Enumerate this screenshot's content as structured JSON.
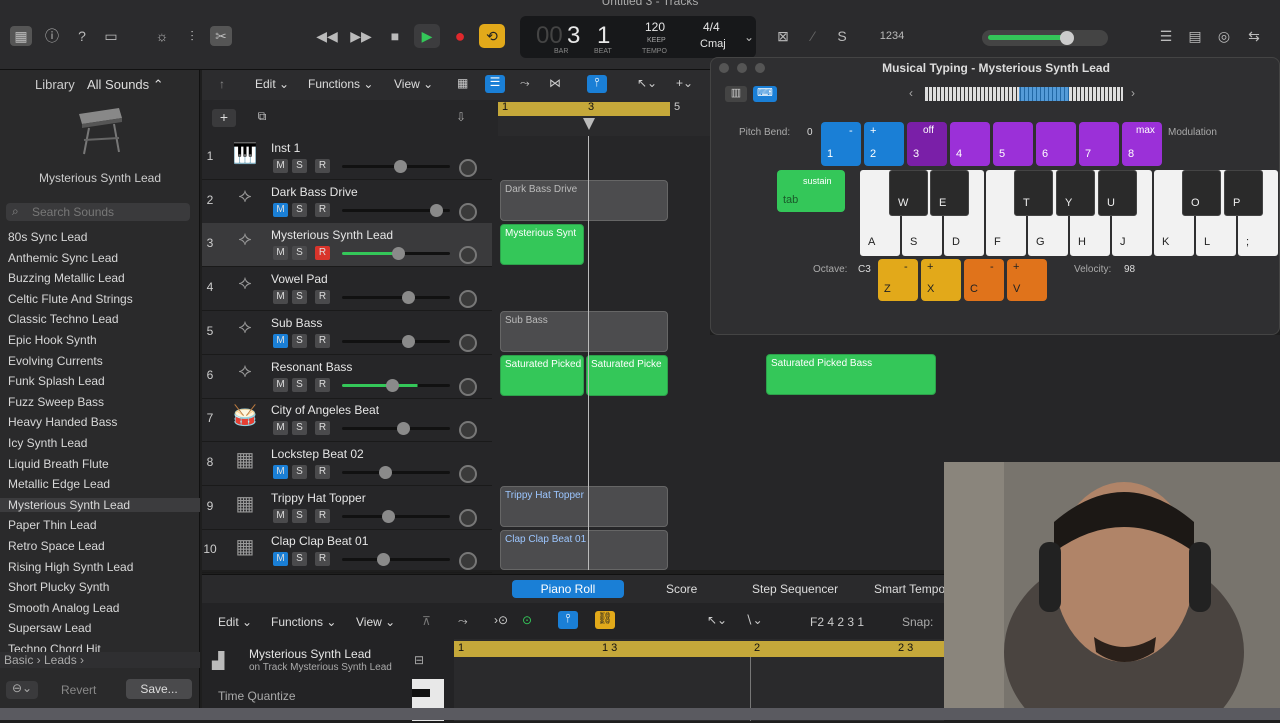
{
  "window_title": "Untitled 3 - Tracks",
  "lcd": {
    "bar": "3",
    "beat": "1",
    "bar_label": "BAR",
    "beat_label": "BEAT",
    "tempo": "120",
    "keep": "KEEP",
    "tempo_label": "TEMPO",
    "signature": "4/4",
    "key": "Cmaj",
    "prefix": "00"
  },
  "toolbar": {
    "count_in": "1234"
  },
  "library": {
    "title": "Library",
    "filter": "All Sounds",
    "selected_patch": "Mysterious Synth Lead",
    "search_placeholder": "Search Sounds",
    "items": [
      "80s Sync Lead",
      "Anthemic Sync Lead",
      "Buzzing Metallic Lead",
      "Celtic Flute And Strings",
      "Classic Techno Lead",
      "Epic Hook Synth",
      "Evolving Currents",
      "Funk Splash Lead",
      "Fuzz Sweep Bass",
      "Heavy Handed Bass",
      "Icy Synth Lead",
      "Liquid Breath Flute",
      "Metallic Edge Lead",
      "Mysterious Synth Lead",
      "Paper Thin Lead",
      "Retro Space Lead",
      "Rising High Synth Lead",
      "Short Plucky Synth",
      "Smooth Analog Lead",
      "Supersaw Lead",
      "Techno Chord Hit"
    ],
    "breadcrumb": "Basic › Leads ›",
    "revert": "Revert",
    "save": "Save..."
  },
  "tracks_menu": {
    "edit": "Edit",
    "functions": "Functions",
    "view": "View"
  },
  "ruler": {
    "m1": "1",
    "m3": "3",
    "m5": "5"
  },
  "tracks": [
    {
      "num": "1",
      "name": "Inst 1",
      "m": "M",
      "s": "S",
      "r": "R",
      "vol": 0.52
    },
    {
      "num": "2",
      "name": "Dark Bass Drive",
      "m": "M",
      "s": "S",
      "r": "R",
      "vol": 0.88
    },
    {
      "num": "3",
      "name": "Mysterious Synth Lead",
      "m": "M",
      "s": "S",
      "r": "R",
      "vol": 0.5
    },
    {
      "num": "4",
      "name": "Vowel Pad",
      "m": "M",
      "s": "S",
      "r": "R",
      "vol": 0.6
    },
    {
      "num": "5",
      "name": "Sub Bass",
      "m": "M",
      "s": "S",
      "r": "R",
      "vol": 0.6
    },
    {
      "num": "6",
      "name": "Resonant Bass",
      "m": "M",
      "s": "S",
      "r": "R",
      "vol": 0.44
    },
    {
      "num": "7",
      "name": "City of Angeles Beat",
      "m": "M",
      "s": "S",
      "r": "R",
      "vol": 0.55
    },
    {
      "num": "8",
      "name": "Lockstep Beat 02",
      "m": "M",
      "s": "S",
      "r": "R",
      "vol": 0.37
    },
    {
      "num": "9",
      "name": "Trippy Hat Topper",
      "m": "M",
      "s": "S",
      "r": "R",
      "vol": 0.4
    },
    {
      "num": "10",
      "name": "Clap Clap Beat 01",
      "m": "M",
      "s": "S",
      "r": "R",
      "vol": 0.35
    }
  ],
  "regions": {
    "dark_bass": "Dark Bass Drive",
    "myst": "Mysterious Synt",
    "sub": "Sub Bass",
    "sat1": "Saturated Picked",
    "sat2": "Saturated Picke",
    "sat3": "Saturated Picked Bass",
    "hat": "Trippy Hat Topper",
    "clap": "Clap Clap Beat 01"
  },
  "musical_typing": {
    "title": "Musical Typing - Mysterious Synth Lead",
    "pitch_bend_label": "Pitch Bend:",
    "pitch_bend_value": "0",
    "modulation_label": "Modulation",
    "pb_minus": "-",
    "pb_plus": "+",
    "off": "off",
    "max": "max",
    "nums": [
      "1",
      "2",
      "3",
      "4",
      "5",
      "6",
      "7",
      "8"
    ],
    "sustain": "sustain",
    "tab": "tab",
    "black_keys": [
      "W",
      "E",
      "T",
      "Y",
      "U",
      "O",
      "P"
    ],
    "white_keys": [
      "A",
      "S",
      "D",
      "F",
      "G",
      "H",
      "J",
      "K",
      "L",
      ";"
    ],
    "octave_label": "Octave:",
    "octave_value": "C3",
    "velocity_label": "Velocity:",
    "velocity_value": "98",
    "z": "Z",
    "x": "X",
    "c": "C",
    "v": "V",
    "minus": "-",
    "plus": "+"
  },
  "editor": {
    "tabs": [
      "Piano Roll",
      "Score",
      "Step Sequencer",
      "Smart Tempo"
    ],
    "edit": "Edit",
    "functions": "Functions",
    "view": "View",
    "position": "F2  4 2 3 1",
    "snap": "Snap:",
    "region_name": "Mysterious Synth Lead",
    "track_ref": "on Track Mysterious Synth Lead",
    "time_quantize": "Time Quantize",
    "r1": "1",
    "r13": "1 3",
    "r2": "2",
    "r23": "2 3"
  },
  "colors": {
    "green": "#34c759",
    "blue": "#1a7fd6",
    "purple": "#8e24c6",
    "yellow": "#e2a91a",
    "orange": "#e0731b"
  }
}
